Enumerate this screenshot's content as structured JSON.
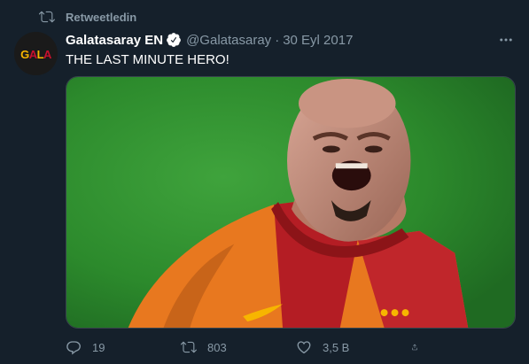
{
  "retweet": {
    "label": "Retweetledin"
  },
  "tweet": {
    "display_name": "Galatasaray EN",
    "handle": "@Galatasaray",
    "separator": "·",
    "date": "30 Eyl 2017",
    "text": "THE LAST MINUTE HERO!",
    "avatar_logo_text": "GALA",
    "media": {
      "description_icon": "celebrating-player-photo"
    }
  },
  "actions": {
    "reply_count": "19",
    "retweet_count": "803",
    "like_count": "3,5 B"
  },
  "colors": {
    "background": "#15202b",
    "muted": "#8899a6",
    "verified": "#ffffff",
    "brand_red": "#a5142b",
    "brand_yellow": "#f7b500"
  }
}
